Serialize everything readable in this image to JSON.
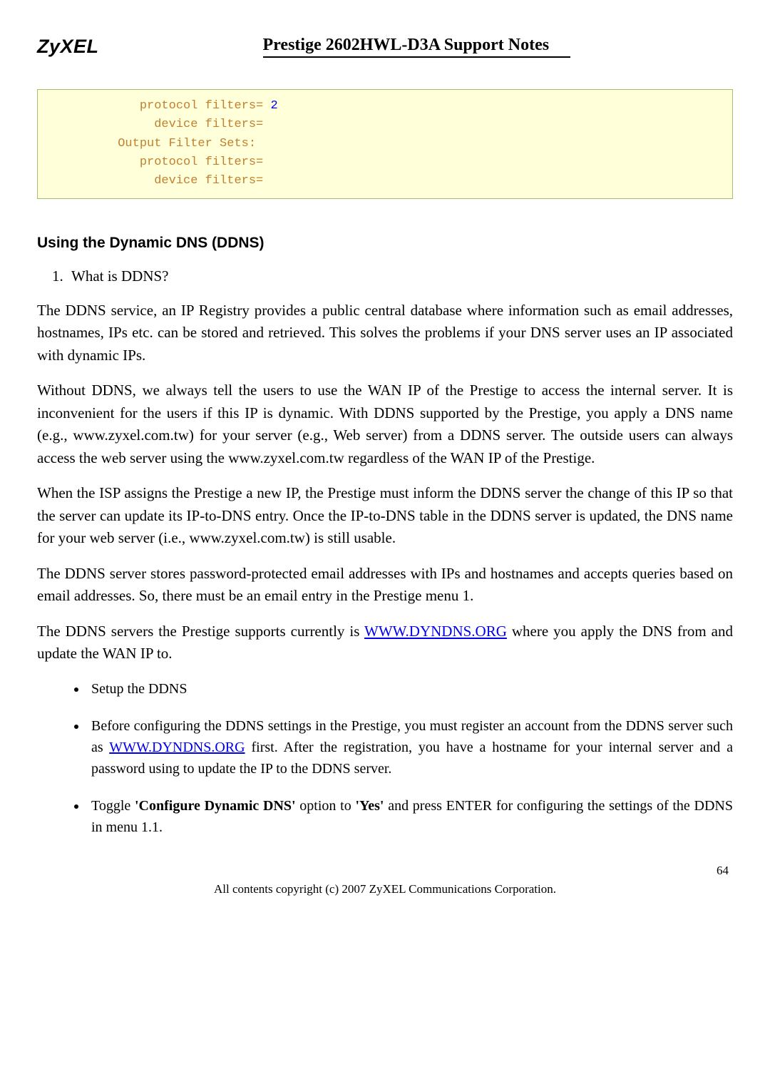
{
  "header": {
    "logo": "ZyXEL",
    "title": "Prestige 2602HWL-D3A Support Notes"
  },
  "code": {
    "l1_a": "              protocol filters= ",
    "l1_b": "2",
    "l2": "                device filters=",
    "l3": "           Output Filter Sets:",
    "l4": "              protocol filters=",
    "l5": "                device filters="
  },
  "section_heading": "Using the Dynamic DNS (DDNS)",
  "list1_item1": "What is DDNS?",
  "p1": "The DDNS service, an IP Registry provides a public central database where information such as email addresses, hostnames, IPs etc. can be stored and retrieved. This solves the problems if your DNS server uses an IP associated with dynamic IPs.",
  "p2": "Without DDNS, we always tell the users to use the WAN IP of the Prestige to access the internal server. It is inconvenient for the users if this IP is dynamic. With DDNS supported by the Prestige, you apply a DNS name (e.g., www.zyxel.com.tw) for your server (e.g., Web server) from a DDNS server. The outside users can always access the web server using the www.zyxel.com.tw regardless of the WAN IP of the Prestige.",
  "p3": "When the ISP assigns the Prestige a new IP, the Prestige must inform the DDNS server the change of this IP so that the server can update its IP-to-DNS entry. Once the IP-to-DNS table in the DDNS server is updated, the DNS name for your web server (i.e., www.zyxel.com.tw) is still usable.",
  "p4": "The DDNS server stores password-protected email addresses with IPs and hostnames and accepts queries based on email addresses. So, there must be an email entry in the Prestige menu 1.",
  "p5_a": "The DDNS servers the Prestige supports currently is ",
  "p5_link": "WWW.DYNDNS.ORG",
  "p5_b": " where you apply the DNS from and update the WAN IP to.",
  "b1": "Setup the DDNS",
  "b2_a": "Before configuring the DDNS settings in the Prestige, you must register an account from the DDNS server such as ",
  "b2_link": "WWW.DYNDNS.ORG",
  "b2_b": " first. After the registration, you have a hostname for your internal server and a password using to update the IP to the DDNS server.",
  "b3_a": "Toggle ",
  "b3_bold1": "'Configure Dynamic DNS'",
  "b3_b": " option to ",
  "b3_bold2": "'Yes'",
  "b3_c": " and press ENTER for configuring the settings of the DDNS in menu 1.1.",
  "footer": {
    "page": "64",
    "copyright": "All contents copyright (c) 2007 ZyXEL Communications Corporation."
  }
}
